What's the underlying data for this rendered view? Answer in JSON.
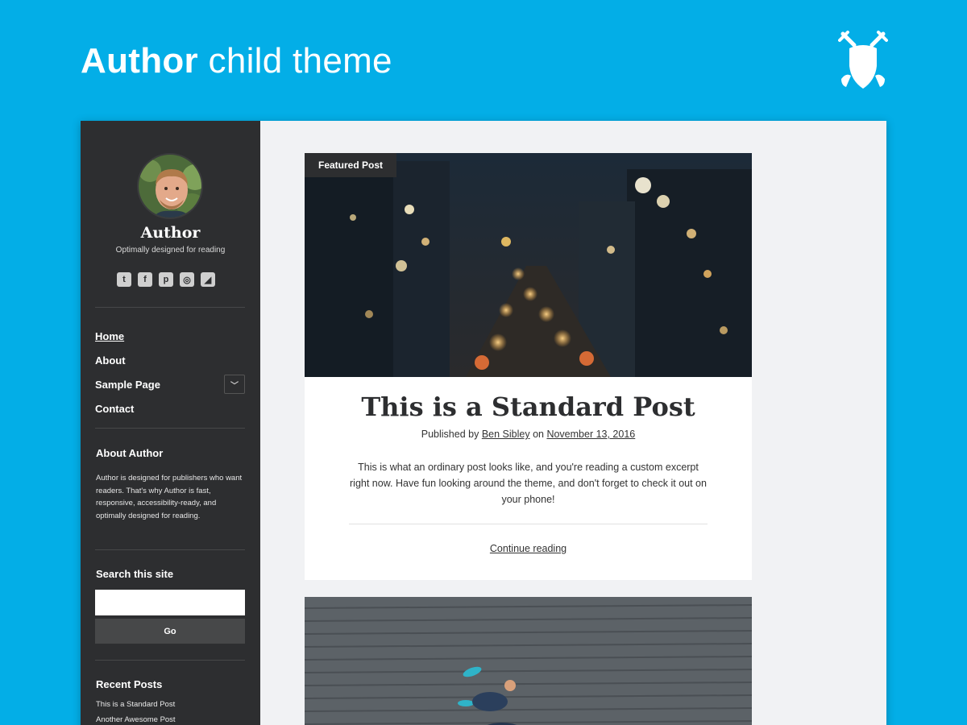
{
  "banner": {
    "title_bold": "Author",
    "title_rest": "child theme",
    "logo_icon": "crossed-swords-shield-logo"
  },
  "sidebar": {
    "site_title": "Author",
    "tagline": "Optimally designed for reading",
    "social_icons": [
      "twitter-icon",
      "facebook-icon",
      "pinterest-icon",
      "instagram-icon",
      "rss-icon"
    ],
    "menu": [
      {
        "label": "Home",
        "current": true
      },
      {
        "label": "About"
      },
      {
        "label": "Sample Page",
        "has_submenu": true
      },
      {
        "label": "Contact"
      }
    ],
    "about_widget": {
      "title": "About Author",
      "text": "Author is designed for publishers who want readers. That's why Author is fast, responsive, accessibility-ready, and optimally designed for reading."
    },
    "search_widget": {
      "title": "Search this site",
      "input_value": "",
      "button_label": "Go"
    },
    "recent_posts_widget": {
      "title": "Recent Posts",
      "items": [
        "This is a Standard Post",
        "Another Awesome Post"
      ]
    }
  },
  "main": {
    "post": {
      "badge": "Featured Post",
      "title": "This is a Standard Post",
      "meta_prefix": "Published by",
      "author": "Ben Sibley",
      "meta_on": "on",
      "date": "November 13, 2016",
      "excerpt": "This is what an ordinary post looks like, and you're reading a custom excerpt right now. Have fun looking around the theme, and don't forget to check it out on your phone!",
      "continue_label": "Continue reading"
    }
  },
  "colors": {
    "banner_bg": "#03aee7",
    "sidebar_bg": "#2d2e30",
    "content_bg": "#f1f2f4"
  }
}
